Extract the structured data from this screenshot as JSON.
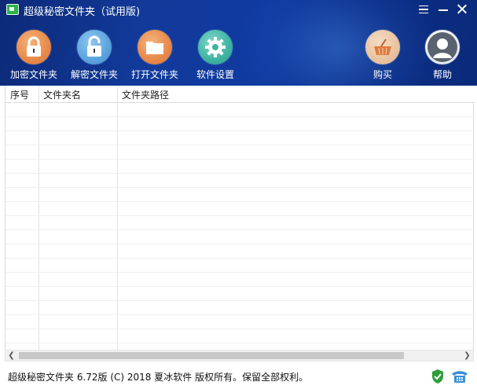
{
  "window": {
    "title": "超级秘密文件夹（试用版)"
  },
  "toolbar": {
    "items": [
      {
        "label": "加密文件夹",
        "icon": "lock-closed-icon"
      },
      {
        "label": "解密文件夹",
        "icon": "lock-open-icon"
      },
      {
        "label": "打开文件夹",
        "icon": "folder-icon"
      },
      {
        "label": "软件设置",
        "icon": "gear-icon"
      },
      {
        "label": "购买",
        "icon": "basket-icon"
      },
      {
        "label": "帮助",
        "icon": "user-icon"
      }
    ]
  },
  "table": {
    "columns": [
      "序号",
      "文件夹名",
      "文件夹路径"
    ],
    "rows": []
  },
  "status": {
    "text": "超级秘密文件夹 6.72版 (C) 2018 夏冰软件 版权所有。保留全部权利。"
  },
  "colors": {
    "header": "#123a9a",
    "lock_orange": "#e8894a",
    "lock_blue": "#5aa3de",
    "gear_teal": "#3fb3a2"
  }
}
